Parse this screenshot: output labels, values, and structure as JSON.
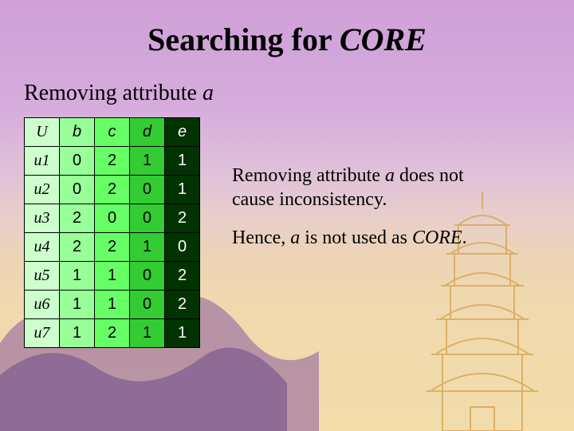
{
  "title_prefix": "Searching for ",
  "title_core": "CORE",
  "subtitle_prefix": "Removing attribute ",
  "subtitle_attr": "a",
  "table": {
    "headers": [
      "U",
      "b",
      "c",
      "d",
      "e"
    ],
    "rows": [
      {
        "label": "u1",
        "cells": [
          "0",
          "2",
          "1",
          "1"
        ]
      },
      {
        "label": "u2",
        "cells": [
          "0",
          "2",
          "0",
          "1"
        ]
      },
      {
        "label": "u3",
        "cells": [
          "2",
          "0",
          "0",
          "2"
        ]
      },
      {
        "label": "u4",
        "cells": [
          "2",
          "2",
          "1",
          "0"
        ]
      },
      {
        "label": "u5",
        "cells": [
          "1",
          "1",
          "0",
          "2"
        ]
      },
      {
        "label": "u6",
        "cells": [
          "1",
          "1",
          "0",
          "2"
        ]
      },
      {
        "label": "u7",
        "cells": [
          "1",
          "2",
          "1",
          "1"
        ]
      }
    ]
  },
  "note1_pre": "Removing attribute ",
  "note1_attr": "a",
  "note1_post": " does not cause inconsistency.",
  "note2_pre": "Hence, ",
  "note2_attr": "a",
  "note2_mid": " is not used as ",
  "note2_core": "CORE",
  "note2_post": "."
}
